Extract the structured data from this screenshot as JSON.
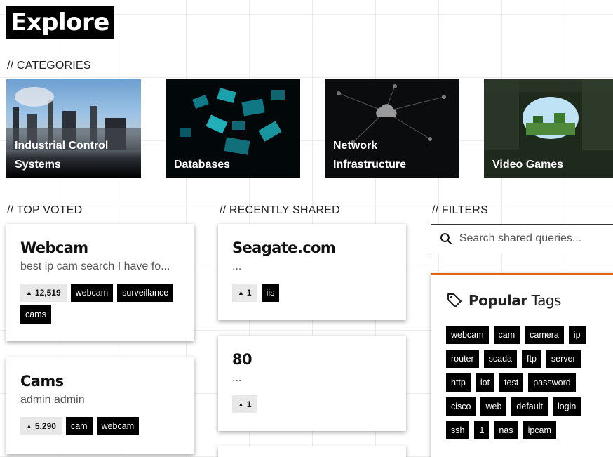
{
  "page": {
    "title": "Explore"
  },
  "sections": {
    "categories": "// CATEGORIES",
    "top_voted": "// TOP VOTED",
    "recently_shared": "// RECENTLY SHARED",
    "filters": "// FILTERS"
  },
  "categories": [
    {
      "line1": "Industrial Control",
      "line2": "Systems"
    },
    {
      "line1": "",
      "line2": "Databases"
    },
    {
      "line1": "Network",
      "line2": "Infrastructure"
    },
    {
      "line1": "",
      "line2": "Video Games"
    }
  ],
  "top_voted": [
    {
      "title": "Webcam",
      "desc": "best ip cam search I have fo...",
      "votes": "12,519",
      "tags": [
        "webcam",
        "surveillance",
        "cams"
      ]
    },
    {
      "title": "Cams",
      "desc": "admin admin",
      "votes": "5,290",
      "tags": [
        "cam",
        "webcam"
      ]
    }
  ],
  "recently_shared": [
    {
      "title": "Seagate.com",
      "desc": "...",
      "votes": "1",
      "tags": [
        "iis"
      ]
    },
    {
      "title": "80",
      "desc": "...",
      "votes": "1",
      "tags": []
    }
  ],
  "filters": {
    "search_placeholder": "Search shared queries...",
    "popular_bold": "Popular",
    "popular_rest": "Tags",
    "tags": [
      "webcam",
      "cam",
      "camera",
      "ip",
      "router",
      "scada",
      "ftp",
      "server",
      "http",
      "iot",
      "test",
      "password",
      "cisco",
      "web",
      "default",
      "login",
      "ssh",
      "1",
      "nas",
      "ipcam"
    ]
  },
  "colors": {
    "accent": "#e8630f",
    "chip_dark": "#000000",
    "vote_bg": "#e8e8e8"
  }
}
